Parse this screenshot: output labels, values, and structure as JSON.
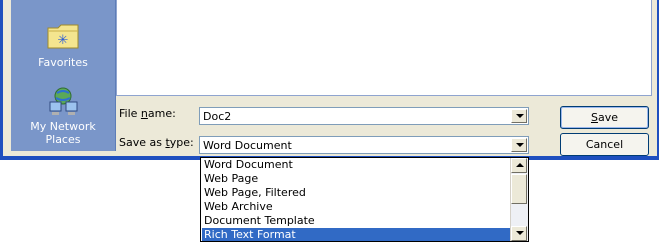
{
  "places": {
    "favorites_label": "Favorites",
    "network_label_line1": "My Network",
    "network_label_line2": "Places"
  },
  "form": {
    "file_name_prefix": "File ",
    "file_name_underlined": "n",
    "file_name_suffix": "ame:",
    "file_name_value": "Doc2",
    "save_as_prefix": "Save as ",
    "save_as_underlined": "t",
    "save_as_suffix": "ype:",
    "save_as_value": "Word Document"
  },
  "buttons": {
    "save_underlined": "S",
    "save_rest": "ave",
    "cancel": "Cancel"
  },
  "type_options": [
    "Word Document",
    "Web Page",
    "Web Page, Filtered",
    "Web Archive",
    "Document Template",
    "Rich Text Format"
  ],
  "selected_option": "Rich Text Format",
  "icons": [
    "folder-star-icon",
    "network-places-icon",
    "chevron-down-icon",
    "scroll-up-icon",
    "scroll-down-icon"
  ],
  "colors": {
    "accent": "#316ac5",
    "places_bar": "#7a96c9",
    "dialog_bg": "#ece9d8"
  }
}
